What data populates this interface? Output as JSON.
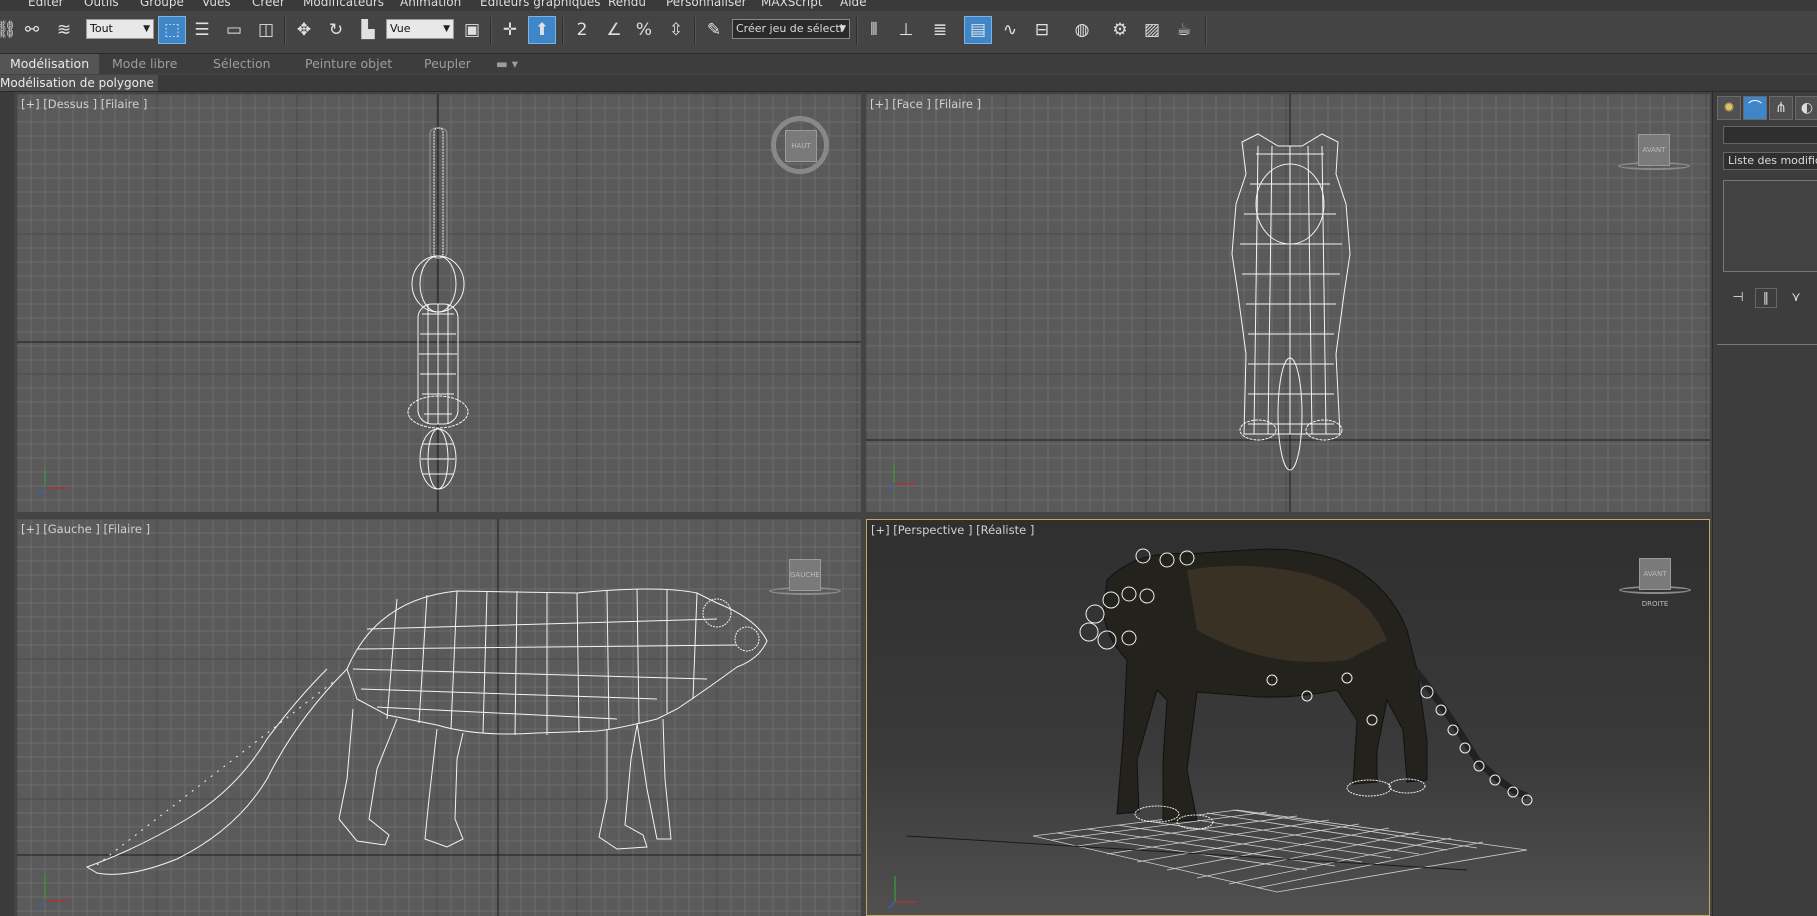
{
  "menu": {
    "items": [
      "Editer",
      "Outils",
      "Groupe",
      "Vues",
      "Créer",
      "Modificateurs",
      "Animation",
      "Editeurs graphiques",
      "Rendu",
      "Personnaliser",
      "MAXScript",
      "Aide"
    ]
  },
  "toolbar": {
    "selection_filter": "Tout",
    "reference_coord": "Vue",
    "named_selection_placeholder": "Créer jeu de sélecti",
    "snap_toggle_label": "2",
    "percent_snap_label": "%"
  },
  "ribbon": {
    "tabs": [
      "Modélisation",
      "Mode libre",
      "Sélection",
      "Peinture objet",
      "Peupler"
    ],
    "active_tab": "Modélisation",
    "sub_label": "Modélisation de polygone"
  },
  "viewports": {
    "top": {
      "label": "[+] [Dessus ] [Filaire ]",
      "cube": "HAUT"
    },
    "front": {
      "label": "[+] [Face ] [Filaire ]",
      "cube": "AVANT"
    },
    "left": {
      "label": "[+] [Gauche ] [Filaire ]",
      "cube": "GAUCHE"
    },
    "perspective": {
      "label": "[+] [Perspective ] [Réaliste ]",
      "cube": "AVANT DROITE"
    }
  },
  "command_panel": {
    "modifier_list": "Liste des modificate"
  },
  "colors": {
    "accent": "#3e86c8",
    "active_viewport_border": "#c6a85a",
    "viewport_bg": "#5a5a5a",
    "wireframe": "#ffffff"
  }
}
